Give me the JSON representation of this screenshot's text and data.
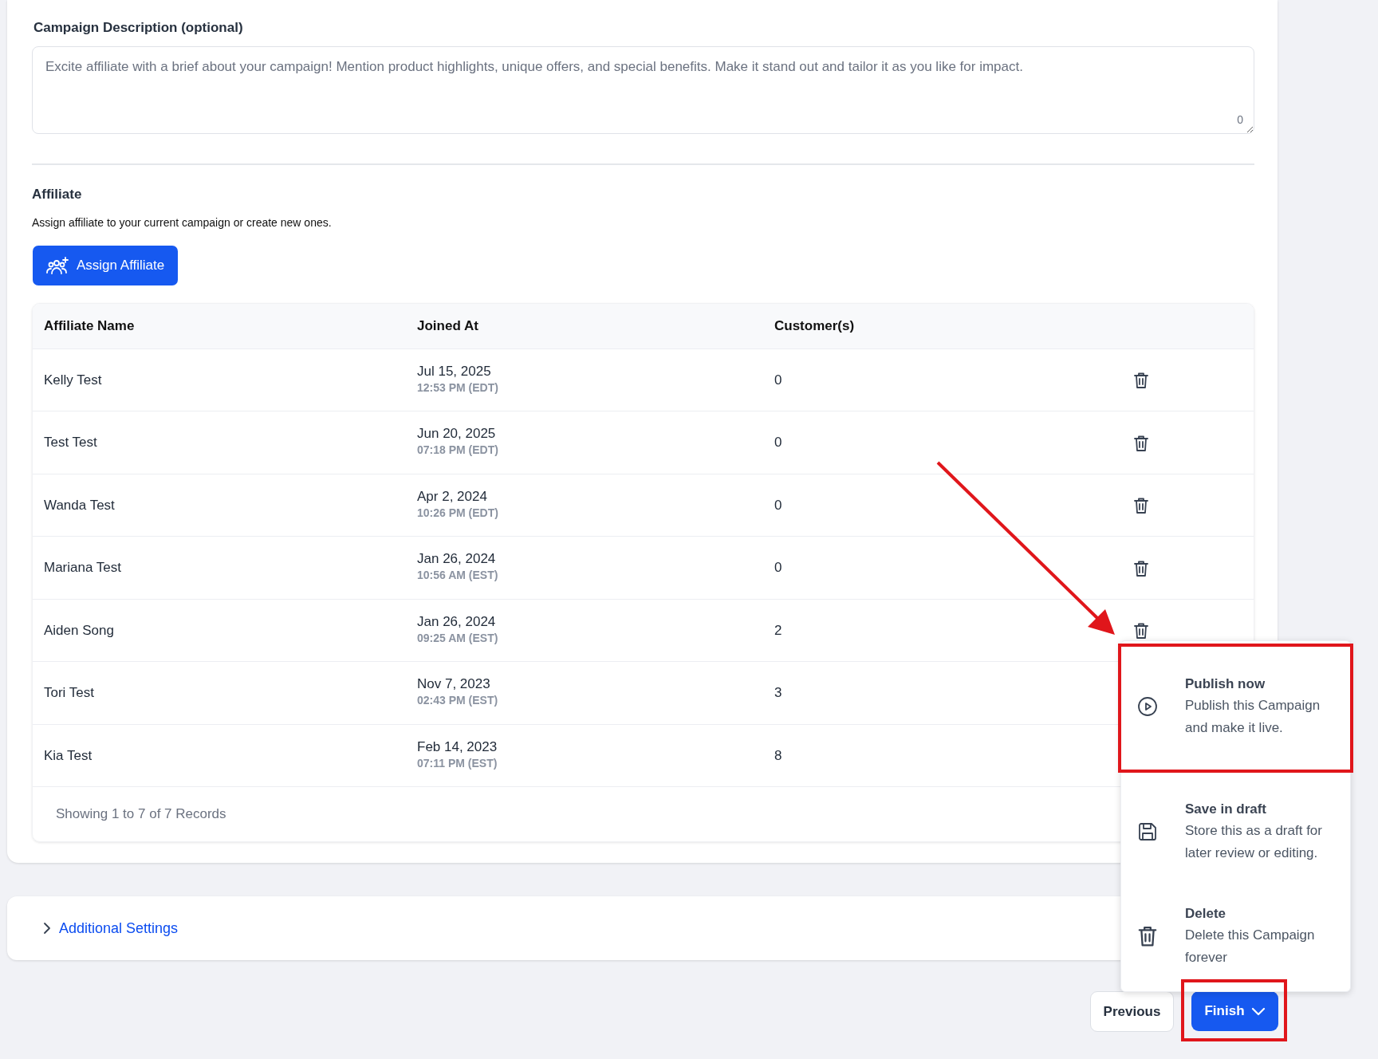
{
  "description": {
    "label": "Campaign Description (optional)",
    "placeholder": "Excite affiliate with a brief about your campaign! Mention product highlights, unique offers, and special benefits. Make it stand out and tailor it as you like for impact.",
    "counter": "0"
  },
  "affiliate": {
    "title": "Affiliate",
    "subtitle": "Assign affiliate to your current campaign or create new ones.",
    "assign_button": "Assign Affiliate"
  },
  "table": {
    "columns": [
      "Affiliate Name",
      "Joined At",
      "Customer(s)"
    ],
    "rows": [
      {
        "name": "Kelly Test",
        "date": "Jul 15, 2025",
        "time": "12:53 PM (EDT)",
        "customers": "0",
        "kind": "deletable"
      },
      {
        "name": "Test Test",
        "date": "Jun 20, 2025",
        "time": "07:18 PM (EDT)",
        "customers": "0",
        "kind": "deletable"
      },
      {
        "name": "Wanda Test",
        "date": "Apr 2, 2024",
        "time": "10:26 PM (EDT)",
        "customers": "0",
        "kind": "deletable"
      },
      {
        "name": "Mariana Test",
        "date": "Jan 26, 2024",
        "time": "10:56 AM (EST)",
        "customers": "0",
        "kind": "deletable"
      },
      {
        "name": "Aiden Song",
        "date": "Jan 26, 2024",
        "time": "09:25 AM (EST)",
        "customers": "2",
        "kind": "deletable"
      },
      {
        "name": "Tori Test",
        "date": "Nov 7, 2023",
        "time": "02:43 PM (EST)",
        "customers": "3",
        "kind": "plain"
      },
      {
        "name": "Kia Test",
        "date": "Feb 14, 2023",
        "time": "07:11 PM (EST)",
        "customers": "8",
        "kind": "plain"
      }
    ],
    "footer": "Showing 1 to 7 of 7 Records"
  },
  "additional_settings": {
    "label": "Additional Settings",
    "expanded": false
  },
  "footer_buttons": {
    "previous": "Previous",
    "finish": {
      "label": "Finish",
      "expanded": true
    }
  },
  "finish_menu": [
    {
      "kind": "publish",
      "title": "Publish now",
      "description": "Publish this Campaign and make it live.",
      "highlighted": true
    },
    {
      "kind": "draft",
      "title": "Save in draft",
      "description": "Store this as a draft for later review or editing.",
      "highlighted": false
    },
    {
      "kind": "delete",
      "title": "Delete",
      "description": "Delete this Campaign forever",
      "highlighted": false
    }
  ]
}
